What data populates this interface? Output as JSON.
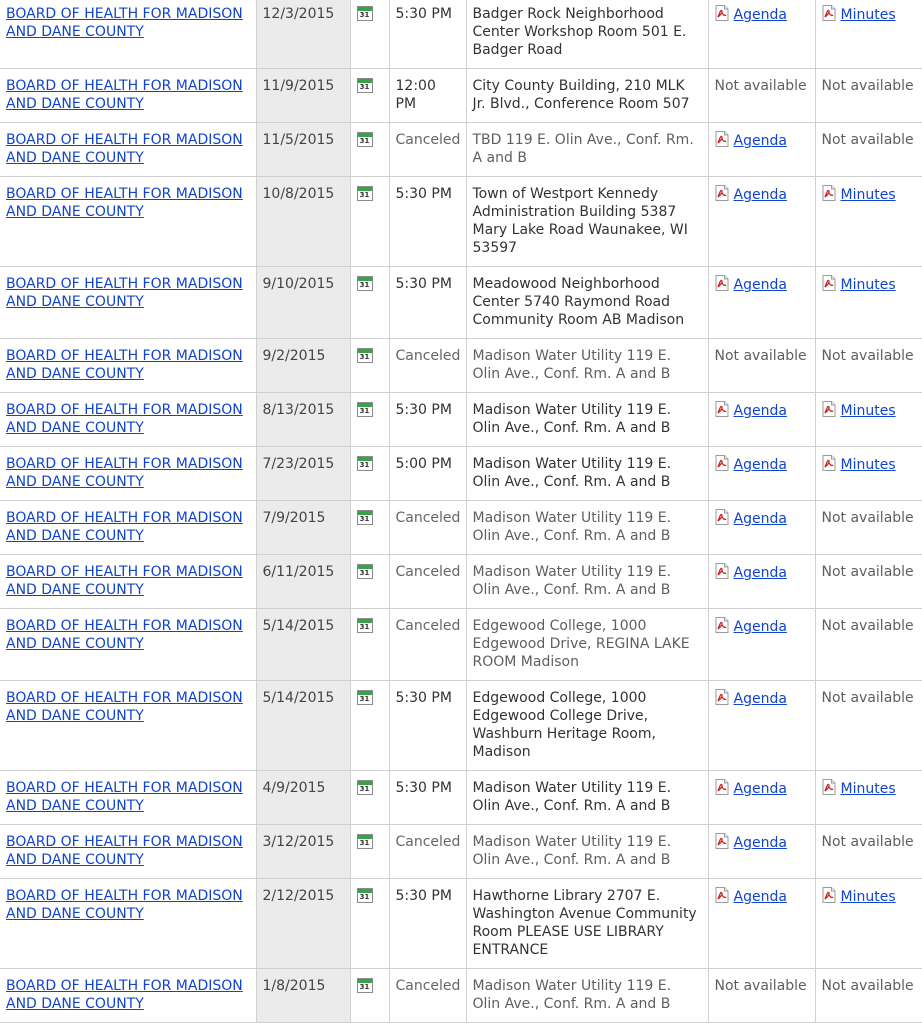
{
  "calendar_icon_label": "31",
  "colors": {
    "link": "#1144cc",
    "date_column_bg": "#ebebeb",
    "calendar_icon_accent": "#3aa04a",
    "pdf_icon_accent": "#cc2222"
  },
  "meetings": [
    {
      "body": "BOARD OF HEALTH FOR MADISON AND DANE COUNTY",
      "date": "12/3/2015",
      "time": "5:30 PM",
      "location": "Badger Rock Neighborhood Center Workshop Room 501 E. Badger Road",
      "agenda": "Agenda",
      "minutes": "Minutes",
      "canceled": false
    },
    {
      "body": "BOARD OF HEALTH FOR MADISON AND DANE COUNTY",
      "date": "11/9/2015",
      "time": "12:00 PM",
      "location": "City County Building, 210 MLK Jr. Blvd., Conference Room 507",
      "agenda": "Not available",
      "minutes": "Not available",
      "canceled": false
    },
    {
      "body": "BOARD OF HEALTH FOR MADISON AND DANE COUNTY",
      "date": "11/5/2015",
      "time": "Canceled",
      "location": "TBD 119 E. Olin Ave., Conf. Rm. A and B",
      "agenda": "Agenda",
      "minutes": "Not available",
      "canceled": true
    },
    {
      "body": "BOARD OF HEALTH FOR MADISON AND DANE COUNTY",
      "date": "10/8/2015",
      "time": "5:30 PM",
      "location": "Town of Westport Kennedy Administration Building 5387 Mary Lake Road Waunakee, WI 53597",
      "agenda": "Agenda",
      "minutes": "Minutes",
      "canceled": false
    },
    {
      "body": "BOARD OF HEALTH FOR MADISON AND DANE COUNTY",
      "date": "9/10/2015",
      "time": "5:30 PM",
      "location": "Meadowood Neighborhood Center 5740 Raymond Road Community Room AB Madison",
      "agenda": "Agenda",
      "minutes": "Minutes",
      "canceled": false
    },
    {
      "body": "BOARD OF HEALTH FOR MADISON AND DANE COUNTY",
      "date": "9/2/2015",
      "time": "Canceled",
      "location": "Madison Water Utility 119 E. Olin Ave., Conf. Rm. A and B",
      "agenda": "Not available",
      "minutes": "Not available",
      "canceled": true
    },
    {
      "body": "BOARD OF HEALTH FOR MADISON AND DANE COUNTY",
      "date": "8/13/2015",
      "time": "5:30 PM",
      "location": "Madison Water Utility 119 E. Olin Ave., Conf. Rm. A and B",
      "agenda": "Agenda",
      "minutes": "Minutes",
      "canceled": false
    },
    {
      "body": "BOARD OF HEALTH FOR MADISON AND DANE COUNTY",
      "date": "7/23/2015",
      "time": "5:00 PM",
      "location": "Madison Water Utility 119 E. Olin Ave., Conf. Rm. A and B",
      "agenda": "Agenda",
      "minutes": "Minutes",
      "canceled": false
    },
    {
      "body": "BOARD OF HEALTH FOR MADISON AND DANE COUNTY",
      "date": "7/9/2015",
      "time": "Canceled",
      "location": "Madison Water Utility 119 E. Olin Ave., Conf. Rm. A and B",
      "agenda": "Agenda",
      "minutes": "Not available",
      "canceled": true
    },
    {
      "body": "BOARD OF HEALTH FOR MADISON AND DANE COUNTY",
      "date": "6/11/2015",
      "time": "Canceled",
      "location": "Madison Water Utility 119 E. Olin Ave., Conf. Rm. A and B",
      "agenda": "Agenda",
      "minutes": "Not available",
      "canceled": true
    },
    {
      "body": "BOARD OF HEALTH FOR MADISON AND DANE COUNTY",
      "date": "5/14/2015",
      "time": "Canceled",
      "location": "Edgewood College, 1000 Edgewood Drive, REGINA LAKE ROOM Madison",
      "agenda": "Agenda",
      "minutes": "Not available",
      "canceled": true
    },
    {
      "body": "BOARD OF HEALTH FOR MADISON AND DANE COUNTY",
      "date": "5/14/2015",
      "time": "5:30 PM",
      "location": "Edgewood College, 1000 Edgewood College Drive, Washburn Heritage Room, Madison",
      "agenda": "Agenda",
      "minutes": "Not available",
      "canceled": false
    },
    {
      "body": "BOARD OF HEALTH FOR MADISON AND DANE COUNTY",
      "date": "4/9/2015",
      "time": "5:30 PM",
      "location": "Madison Water Utility 119 E. Olin Ave., Conf. Rm. A and B",
      "agenda": "Agenda",
      "minutes": "Minutes",
      "canceled": false
    },
    {
      "body": "BOARD OF HEALTH FOR MADISON AND DANE COUNTY",
      "date": "3/12/2015",
      "time": "Canceled",
      "location": "Madison Water Utility 119 E. Olin Ave., Conf. Rm. A and B",
      "agenda": "Agenda",
      "minutes": "Not available",
      "canceled": true
    },
    {
      "body": "BOARD OF HEALTH FOR MADISON AND DANE COUNTY",
      "date": "2/12/2015",
      "time": "5:30 PM",
      "location": "Hawthorne Library 2707 E. Washington Avenue Community Room PLEASE USE LIBRARY ENTRANCE",
      "agenda": "Agenda",
      "minutes": "Minutes",
      "canceled": false
    },
    {
      "body": "BOARD OF HEALTH FOR MADISON AND DANE COUNTY",
      "date": "1/8/2015",
      "time": "Canceled",
      "location": "Madison Water Utility 119 E. Olin Ave., Conf. Rm. A and B",
      "agenda": "Not available",
      "minutes": "Not available",
      "canceled": true
    }
  ]
}
